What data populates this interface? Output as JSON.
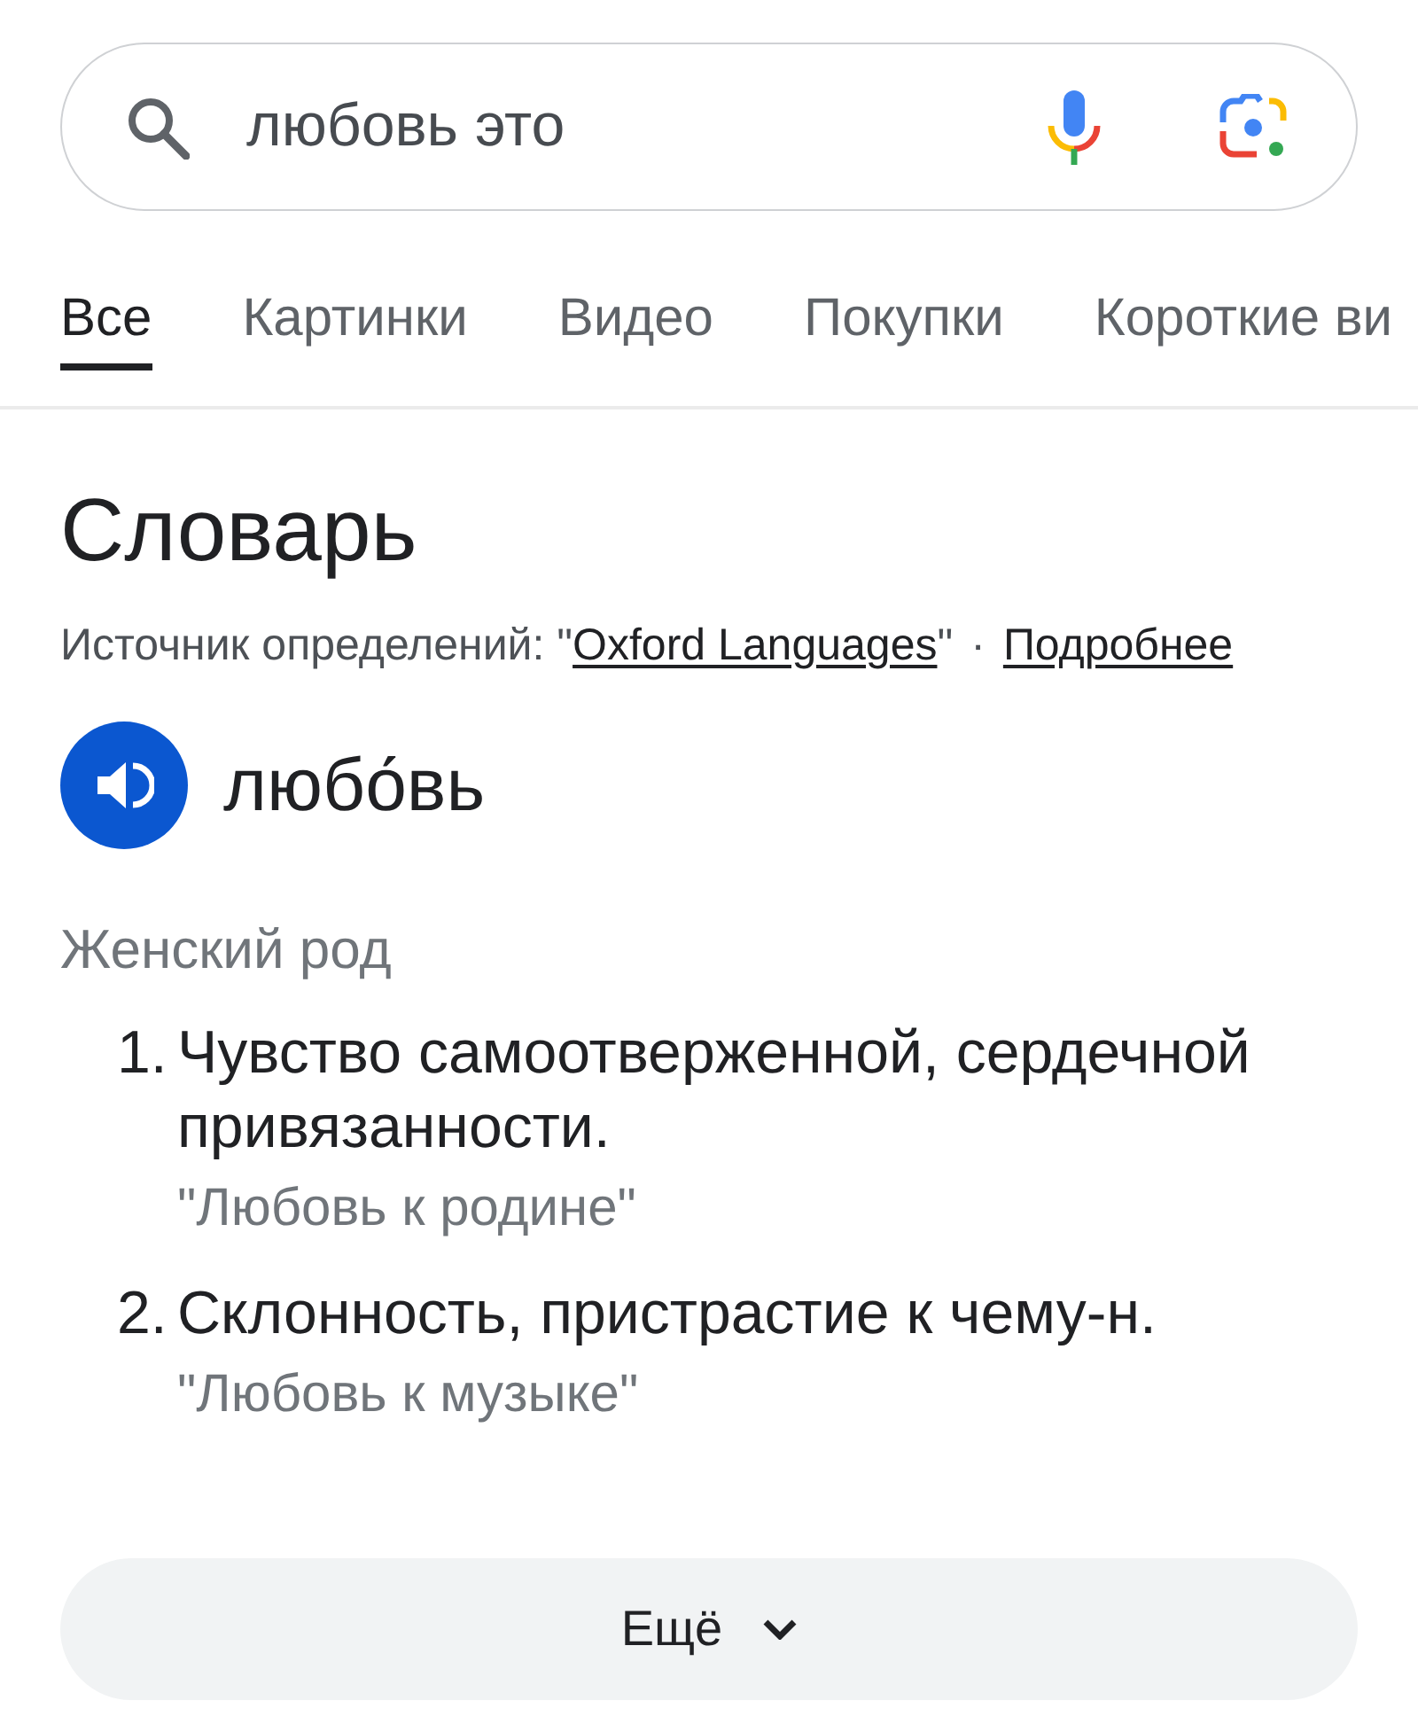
{
  "search": {
    "value": "любовь это"
  },
  "tabs": [
    {
      "label": "Все",
      "selected": true
    },
    {
      "label": "Картинки",
      "selected": false
    },
    {
      "label": "Видео",
      "selected": false
    },
    {
      "label": "Покупки",
      "selected": false
    },
    {
      "label": "Короткие ви",
      "selected": false
    }
  ],
  "dictionary": {
    "title": "Словарь",
    "source": {
      "prefix": "Источник определений: \"",
      "link": "Oxford Languages",
      "suffix": "\"",
      "separator": "·",
      "more": "Подробнее"
    },
    "word": "любо́вь",
    "part_of_speech": "Женский род",
    "definitions": [
      {
        "number": "1.",
        "text": "Чувство самоотверженной, сердечной привязанности.",
        "example": "\"Любовь к родине\""
      },
      {
        "number": "2.",
        "text": "Склонность, пристрастие к чему-н.",
        "example": "\"Любовь к музыке\""
      }
    ]
  },
  "more_button": {
    "label": "Ещё"
  }
}
